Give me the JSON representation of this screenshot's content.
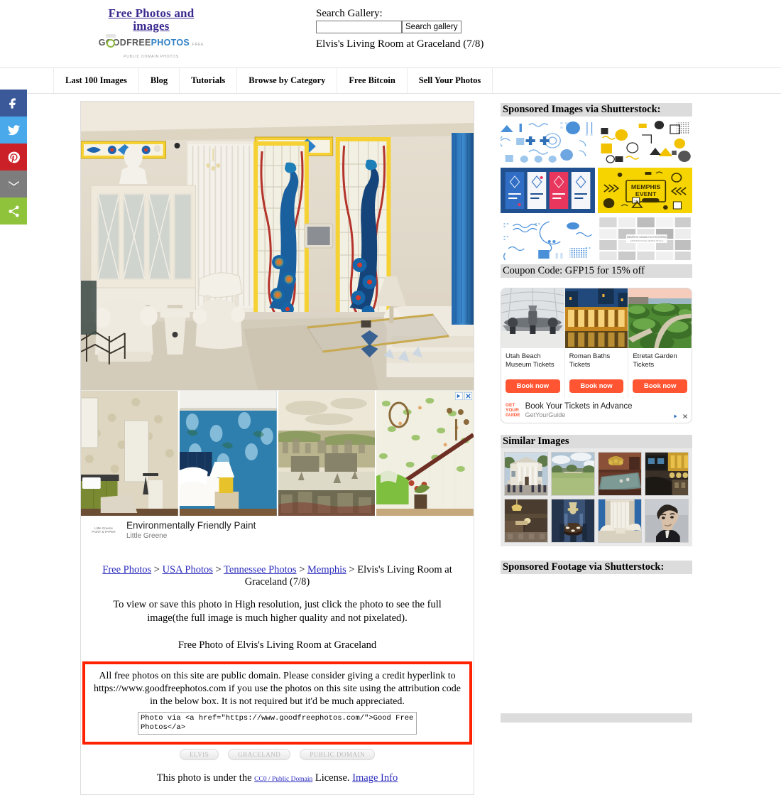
{
  "header": {
    "brand_title": "Free Photos and images",
    "logo_word_1": "GOODFREE",
    "logo_word_2": "PHOTOS",
    "logo_tagline": "FREE PUBLIC DOMAIN PHOTOS",
    "search_label": "Search Gallery:",
    "search_value": "",
    "search_placeholder": "",
    "search_button": "Search gallery",
    "page_subtitle": "Elvis's Living Room at Graceland (7/8)"
  },
  "nav": {
    "items": [
      {
        "label": "Last 100 Images"
      },
      {
        "label": "Blog"
      },
      {
        "label": "Tutorials"
      },
      {
        "label": "Browse by Category"
      },
      {
        "label": "Free Bitcoin"
      },
      {
        "label": "Sell Your Photos"
      }
    ]
  },
  "share": {
    "items": [
      {
        "name": "facebook",
        "color": "#3b5998"
      },
      {
        "name": "twitter",
        "color": "#4aa9ea"
      },
      {
        "name": "pinterest",
        "color": "#cb2027"
      },
      {
        "name": "email",
        "color": "#7d7d7d"
      },
      {
        "name": "share",
        "color": "#90c33c"
      }
    ]
  },
  "main": {
    "photo_alt": "Elvis's Living Room at Graceland",
    "paint_ad": {
      "headline": "Environmentally Friendly Paint",
      "advertiser": "Little Greene",
      "logo_text": "Little Greene",
      "logo_sub": "PAINT & PAPER"
    },
    "breadcrumb": {
      "links": [
        "Free Photos",
        "USA Photos",
        "Tennessee Photos",
        "Memphis"
      ],
      "separator": ">",
      "current": "Elvis's Living Room at Graceland (7/8)"
    },
    "note": "To view or save this photo in High resolution, just click the photo to see the full image(the full image is much higher quality and not pixelated).",
    "free_title": "Free Photo of Elvis's Living Room at Graceland",
    "attribution": {
      "text": "All free photos on this site are public domain. Please consider giving a credit hyperlink to https://www.goodfreephotos.com if you use the photos on this site using the attribution code in the below box. It is not required but it'd be much appreciated.",
      "code": "Photo via <a href=\"https://www.goodfreephotos.com/\">Good Free Photos</a>",
      "border_color": "#ff2200"
    },
    "tags": [
      "ELVIS",
      "GRACELAND",
      "PUBLIC DOMAIN"
    ],
    "license": {
      "prefix": "This photo is under the",
      "link": "CC0 / Public Domain",
      "middle": "License.",
      "info_link": "Image Info"
    }
  },
  "sidebar": {
    "shutterstock_images_heading": "Sponsored Images via Shutterstock:",
    "coupon": "Coupon Code: GFP15 for 15% off",
    "shutterstock_cells": [
      {
        "name": "blue-geometric-icon-set"
      },
      {
        "name": "yellow-black-memphis-shapes"
      },
      {
        "name": "blue-story-templates"
      },
      {
        "name": "memphis-event-yellow-poster"
      },
      {
        "name": "blue-abstract-line-elements"
      },
      {
        "name": "grey-seamless-patterns"
      }
    ],
    "getyourguide": {
      "cards": [
        {
          "title": "Utah Beach Museum Tickets",
          "button": "Book now",
          "image": "aircraft-museum"
        },
        {
          "title": "Roman Baths Tickets",
          "button": "Book now",
          "image": "roman-baths-night"
        },
        {
          "title": "Etretat Garden Tickets",
          "button": "Book now",
          "image": "topiary-garden"
        }
      ],
      "logo_line_1": "GET",
      "logo_line_2": "YOUR",
      "logo_line_3": "GUIDE",
      "headline": "Book Your Tickets in Advance",
      "advertiser": "GetYourGuide",
      "accent": "#ff5533"
    },
    "similar_heading": "Similar Images",
    "similar_images": [
      {
        "name": "graceland-mansion-front"
      },
      {
        "name": "graceland-lawn"
      },
      {
        "name": "graceland-pool-room"
      },
      {
        "name": "graceland-jungle-room-trophy"
      },
      {
        "name": "graceland-kitchen"
      },
      {
        "name": "graceland-dining-room"
      },
      {
        "name": "graceland-white-living-room"
      },
      {
        "name": "elvis-presley-portrait"
      }
    ],
    "footage_heading": "Sponsored Footage via Shutterstock:"
  }
}
